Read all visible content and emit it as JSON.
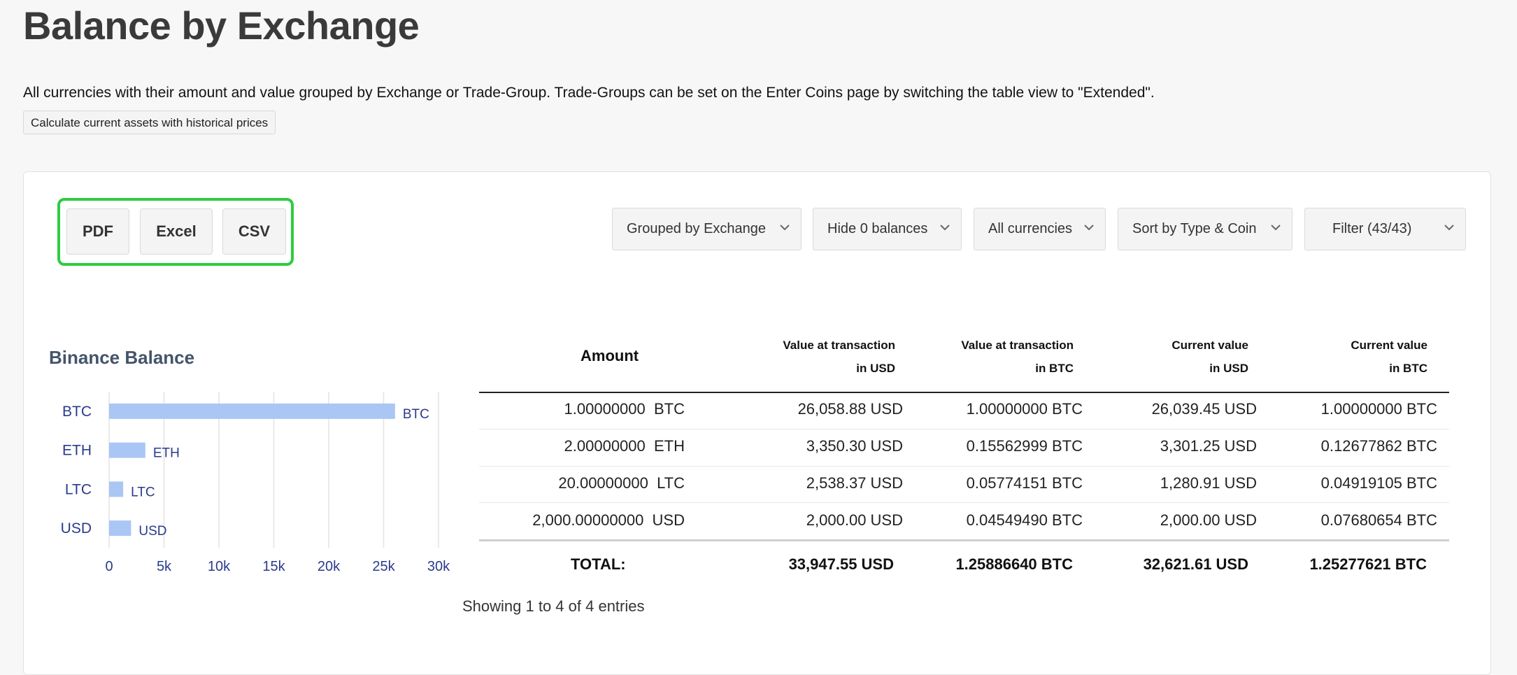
{
  "page": {
    "title": "Balance by Exchange",
    "description": "All currencies with their amount and value grouped by Exchange or Trade-Group. Trade-Groups can be set on the Enter Coins page by switching the table view to \"Extended\".",
    "historical_button": "Calculate current assets with historical prices"
  },
  "export_buttons": [
    "PDF",
    "Excel",
    "CSV"
  ],
  "dropdowns": [
    {
      "label": "Grouped by Exchange"
    },
    {
      "label": "Hide 0 balances"
    },
    {
      "label": "All currencies"
    },
    {
      "label": "Sort by Type & Coin"
    },
    {
      "label": "Filter (43/43)"
    }
  ],
  "colors": {
    "accent_green": "#2ecc40",
    "bar_fill": "#a9c6f5",
    "chart_text": "#2b3a8c",
    "title_text": "#44546a"
  },
  "chart_data": {
    "type": "bar",
    "orientation": "horizontal",
    "title": "Binance Balance",
    "categories": [
      "BTC",
      "ETH",
      "LTC",
      "USD"
    ],
    "values": [
      26039.45,
      3301.25,
      1280.91,
      2000.0
    ],
    "data_labels": [
      "BTC",
      "ETH",
      "LTC",
      "USD"
    ],
    "xlim": [
      0,
      30000
    ],
    "x_ticks": [
      "0",
      "5k",
      "10k",
      "15k",
      "20k",
      "25k",
      "30k"
    ],
    "grid": true
  },
  "table": {
    "headers": [
      {
        "line1": "Amount",
        "line2": ""
      },
      {
        "line1": "Value at transaction",
        "line2": "in USD"
      },
      {
        "line1": "Value at transaction",
        "line2": "in BTC"
      },
      {
        "line1": "Current value",
        "line2": "in USD"
      },
      {
        "line1": "Current value",
        "line2": "in BTC"
      }
    ],
    "rows": [
      [
        "1.00000000  BTC",
        "26,058.88 USD",
        "1.00000000 BTC",
        "26,039.45 USD",
        "1.00000000 BTC"
      ],
      [
        "2.00000000  ETH",
        "3,350.30 USD",
        "0.15562999 BTC",
        "3,301.25 USD",
        "0.12677862 BTC"
      ],
      [
        "20.00000000  LTC",
        "2,538.37 USD",
        "0.05774151 BTC",
        "1,280.91 USD",
        "0.04919105 BTC"
      ],
      [
        "2,000.00000000  USD",
        "2,000.00 USD",
        "0.04549490 BTC",
        "2,000.00 USD",
        "0.07680654 BTC"
      ]
    ],
    "totals": [
      "TOTAL:",
      "33,947.55 USD",
      "1.25886640 BTC",
      "32,621.61 USD",
      "1.25277621 BTC"
    ],
    "info": "Showing 1 to 4 of 4 entries"
  }
}
